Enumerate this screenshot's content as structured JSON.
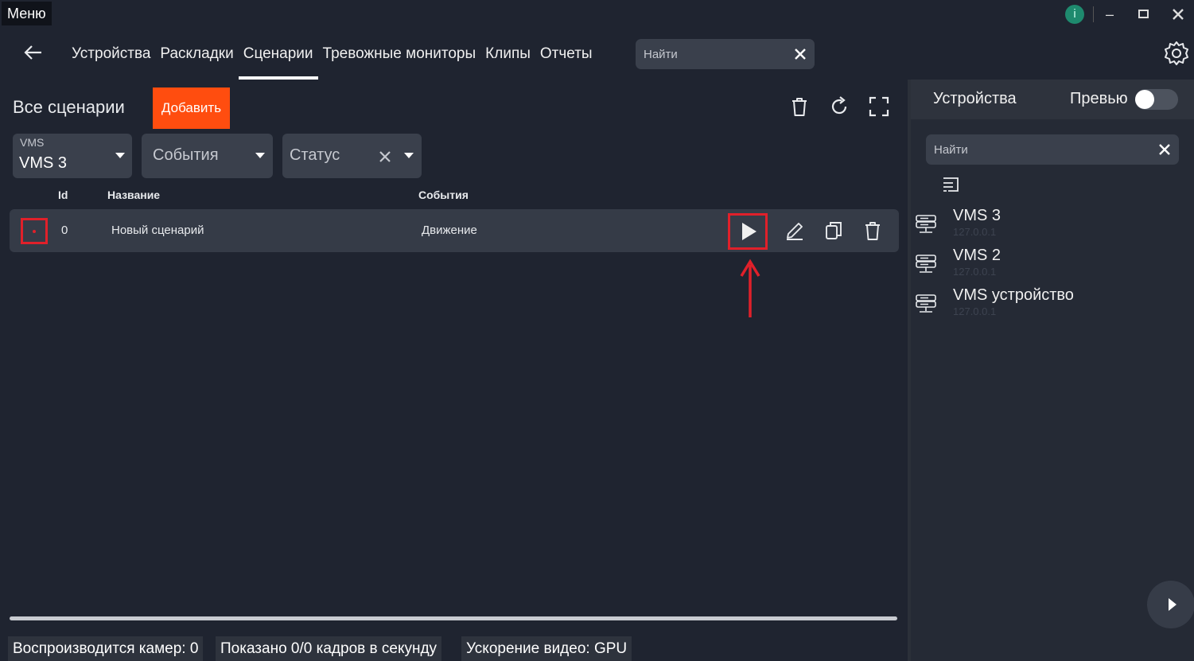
{
  "titlebar": {
    "menu_label": "Меню",
    "info_label": "i"
  },
  "nav": {
    "tabs": [
      "Устройства",
      "Раскладки",
      "Сценарии",
      "Тревожные мониторы",
      "Клипы",
      "Отчеты"
    ],
    "active_tab": 2,
    "search_placeholder": "Найти"
  },
  "main": {
    "title": "Все сценарии",
    "add_label": "Добавить",
    "filters": {
      "vms": {
        "label": "VMS",
        "value": "VMS 3"
      },
      "events": {
        "placeholder": "События"
      },
      "status": {
        "placeholder": "Статус"
      }
    },
    "columns": {
      "id": "Id",
      "name": "Название",
      "events": "События"
    },
    "rows": [
      {
        "id": "0",
        "name": "Новый сценарий",
        "events": "Движение"
      }
    ]
  },
  "statusbar": {
    "cameras": "Воспроизводится камер: 0",
    "fps": "Показано 0/0 кадров в секунду",
    "accel": "Ускорение видео: GPU"
  },
  "side": {
    "title": "Устройства",
    "preview_label": "Превью",
    "preview_on": false,
    "search_placeholder": "Найти",
    "devices": [
      {
        "name": "VMS 3",
        "ip": "127.0.0.1"
      },
      {
        "name": "VMS 2",
        "ip": "127.0.0.1"
      },
      {
        "name": "VMS устройство",
        "ip": "127.0.0.1"
      }
    ]
  },
  "colors": {
    "accent": "#ff4d0f",
    "highlight": "#e0202a",
    "background": "#1f2430"
  }
}
